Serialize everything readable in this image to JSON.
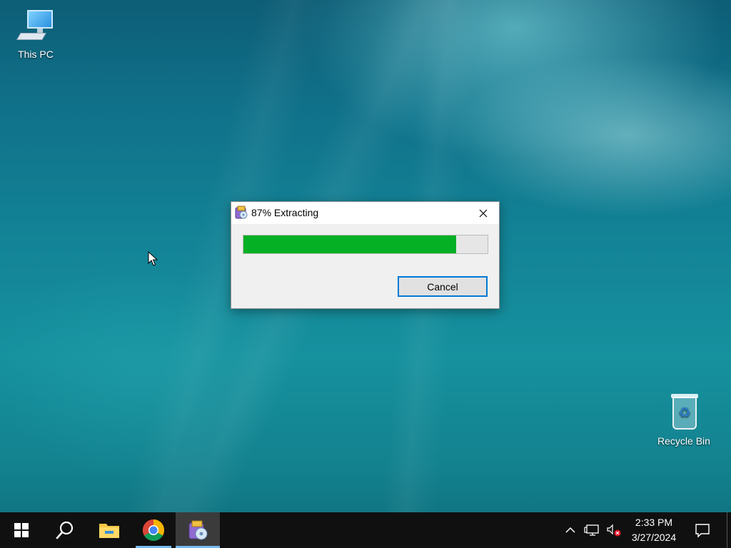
{
  "desktop": {
    "icons": [
      {
        "label": "This PC",
        "icon": "this-pc-icon"
      },
      {
        "label": "Recycle Bin",
        "icon": "recycle-bin-icon"
      }
    ]
  },
  "dialog": {
    "title": "87% Extracting",
    "progress": 0.87,
    "cancel_label": "Cancel",
    "colors": {
      "progress_fill": "#06b025",
      "button_border": "#0078d7"
    }
  },
  "taskbar": {
    "apps": [
      {
        "name": "start",
        "icon": "windows-logo-icon"
      },
      {
        "name": "search",
        "icon": "search-icon"
      },
      {
        "name": "file-explorer",
        "icon": "folder-icon"
      },
      {
        "name": "chrome",
        "icon": "chrome-icon"
      },
      {
        "name": "winrar",
        "icon": "winrar-icon",
        "active": true
      }
    ],
    "tray": {
      "time": "2:33 PM",
      "date": "3/27/2024",
      "icons": [
        "chevron-up-icon",
        "network-icon",
        "volume-muted-icon",
        "notification-icon"
      ]
    }
  }
}
